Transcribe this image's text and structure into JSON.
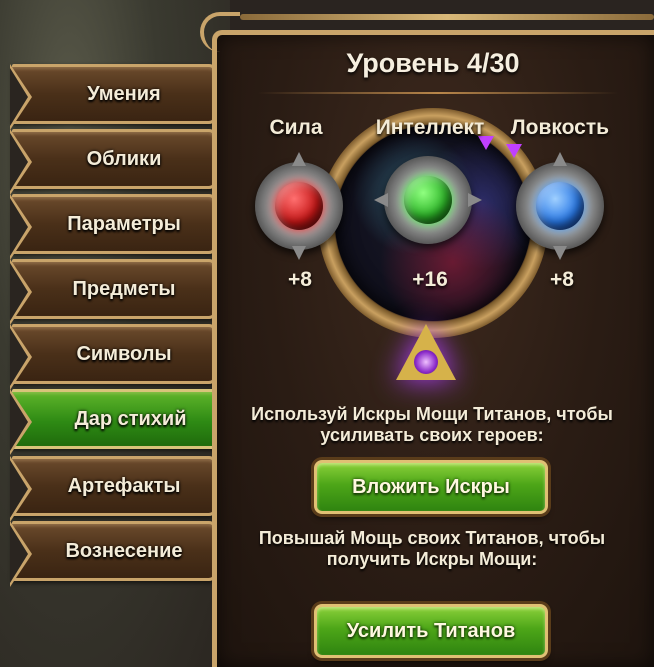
{
  "sidebar": {
    "tabs": [
      {
        "label": "Умения",
        "active": false
      },
      {
        "label": "Облики",
        "active": false
      },
      {
        "label": "Параметры",
        "active": false
      },
      {
        "label": "Предметы",
        "active": false
      },
      {
        "label": "Символы",
        "active": false
      },
      {
        "label": "Дар стихий",
        "active": true
      },
      {
        "label": "Артефакты",
        "active": false
      },
      {
        "label": "Вознесение",
        "active": false
      }
    ]
  },
  "panel": {
    "title": "Уровень 4/30",
    "stats": [
      {
        "label": "Сила",
        "value": "+8",
        "gem_color": "#d82020"
      },
      {
        "label": "Интеллект",
        "value": "+16",
        "gem_color": "#2fb82a"
      },
      {
        "label": "Ловкость",
        "value": "+8",
        "gem_color": "#2a7ae8"
      }
    ],
    "info_1": "Используй Искры Мощи Титанов, чтобы усиливать своих героев:",
    "button_1": "Вложить Искры",
    "info_2": "Повышай Мощь своих Титанов, чтобы получить Искры Мощи:",
    "button_2": "Усилить Титанов"
  },
  "colors": {
    "frame_gold": "#c9a46a",
    "active_tab_green": "#2e8a14",
    "button_green": "#4da618"
  }
}
